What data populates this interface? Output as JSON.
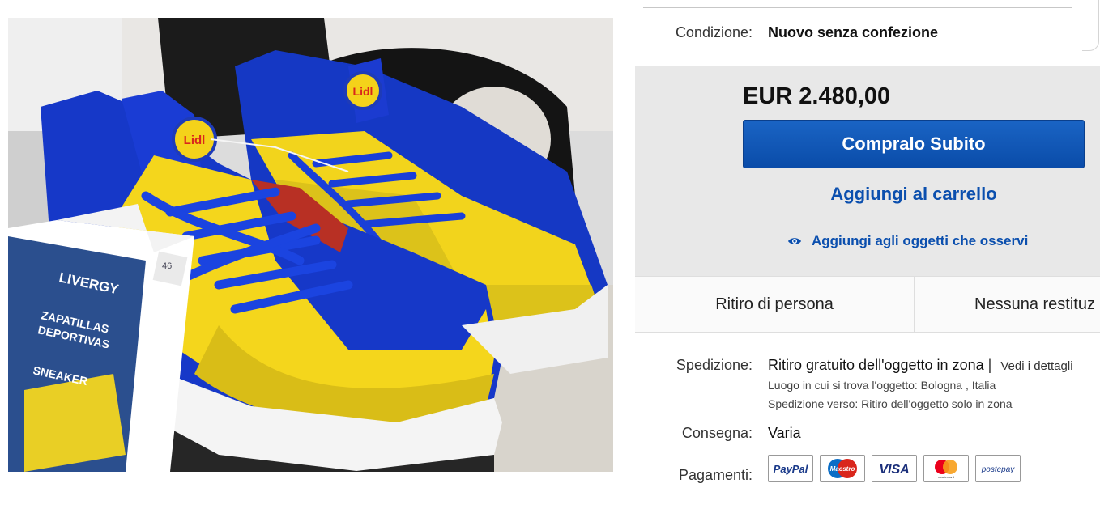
{
  "condition": {
    "label": "Condizione:",
    "value": "Nuovo senza confezione"
  },
  "price": "EUR 2.480,00",
  "buy_now_label": "Compralo Subito",
  "add_to_cart_label": "Aggiungi al carrello",
  "watch_label": "Aggiungi agli oggetti che osservi",
  "options": [
    "Ritiro di persona",
    "Nessuna restituz"
  ],
  "shipping": {
    "label": "Spedizione:",
    "value": "Ritiro gratuito dell'oggetto in zona",
    "separator": "|",
    "details_link": "Vedi i dettagli",
    "location": "Luogo in cui si trova l'oggetto:  Bologna , Italia",
    "ships_to": "Spedizione verso:  Ritiro dell'oggetto solo in zona"
  },
  "delivery": {
    "label": "Consegna:",
    "value": "Varia"
  },
  "payments": {
    "label": "Pagamenti:",
    "methods": [
      "PayPal",
      "Maestro",
      "VISA",
      "mastercard",
      "postepay"
    ]
  },
  "photo": {
    "tag_size": "46",
    "tag_brand": "LIVERGY",
    "tag_line1": "ZAPATILLAS",
    "tag_line2": "DEPORTIVAS",
    "tag_line3": "SNEAKER",
    "logo_text": "Lidl"
  },
  "colors": {
    "accent": "#0b4fae",
    "button": "#0a4ca9",
    "panel_bg": "#e8e8e8"
  }
}
